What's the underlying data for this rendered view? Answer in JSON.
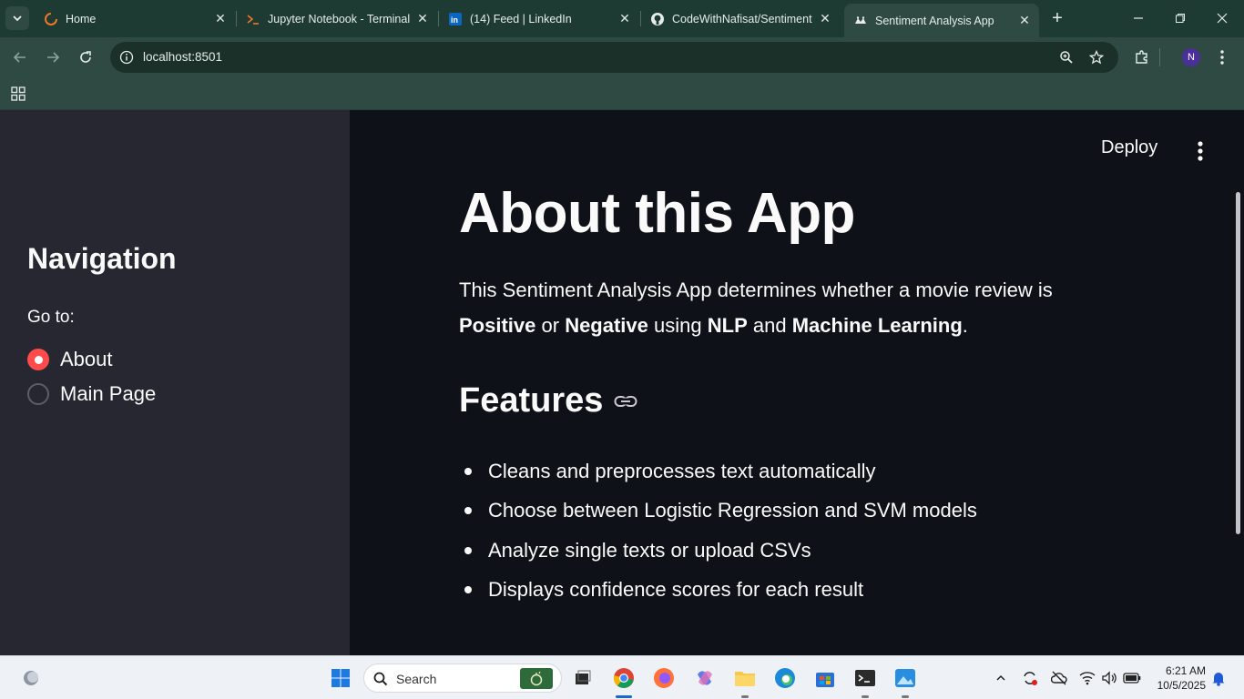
{
  "browser": {
    "tabs": [
      {
        "title": "Home",
        "icon": "spinner-icon"
      },
      {
        "title": "Jupyter Notebook - Terminal",
        "icon": "terminal-icon"
      },
      {
        "title": "(14) Feed | LinkedIn",
        "icon": "linkedin-icon"
      },
      {
        "title": "CodeWithNafisat/Sentiment",
        "icon": "github-icon"
      },
      {
        "title": "Sentiment Analysis App",
        "icon": "streamlit-icon",
        "active": true
      }
    ],
    "url": "localhost:8501",
    "profile_initial": "N"
  },
  "sidebar": {
    "title": "Navigation",
    "goto_label": "Go to:",
    "options": [
      {
        "label": "About",
        "selected": true
      },
      {
        "label": "Main Page",
        "selected": false
      }
    ]
  },
  "main": {
    "deploy_label": "Deploy",
    "title": "About this App",
    "intro": {
      "p1": "This Sentiment Analysis App determines whether a movie review is",
      "positive": "Positive",
      "or": "or",
      "negative": "Negative",
      "using": "using",
      "nlp": "NLP",
      "and": "and",
      "ml": "Machine Learning",
      "end": "."
    },
    "features_heading": "Features",
    "features": [
      "Cleans and preprocesses text automatically",
      "Choose between Logistic Regression and SVM models",
      "Analyze single texts or upload CSVs",
      "Displays confidence scores for each result"
    ]
  },
  "taskbar": {
    "search_placeholder": "Search",
    "time": "6:21 AM",
    "date": "10/5/2025"
  },
  "colors": {
    "accent": "#ff4b4b",
    "sidebar_bg": "#262730",
    "main_bg": "#0e1117",
    "chrome_bg": "#2f4a43"
  }
}
